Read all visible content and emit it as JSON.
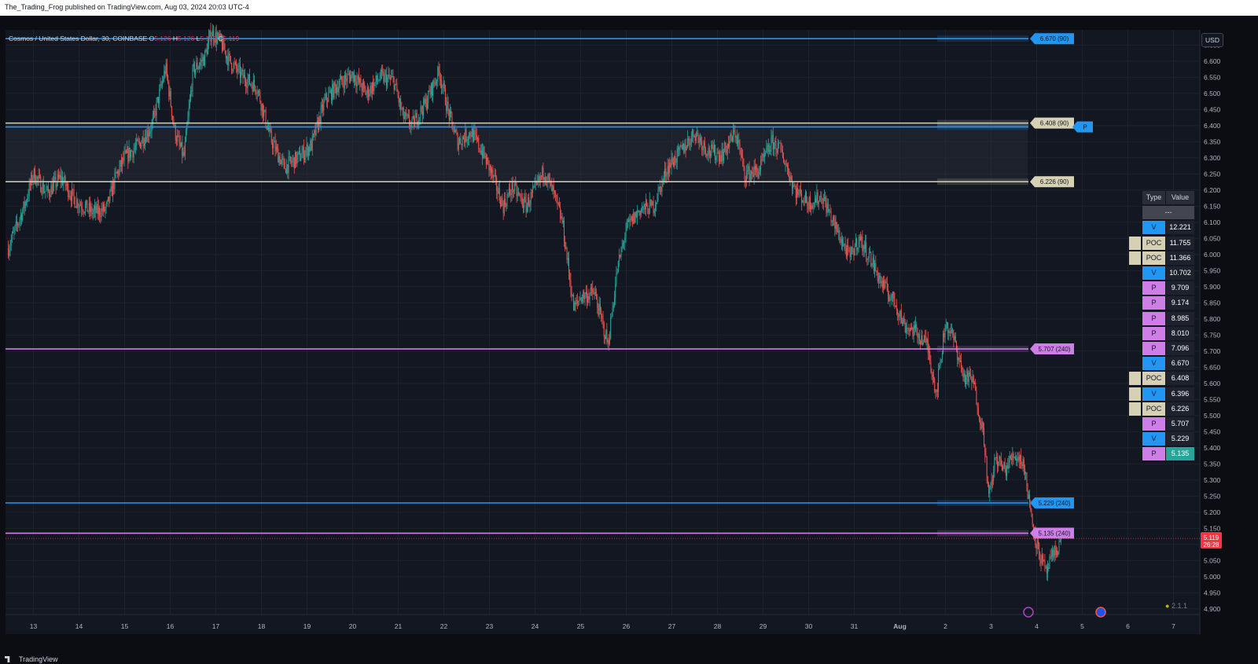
{
  "header": {
    "published_text": "The_Trading_Frog published on TradingView.com, Aug 03, 2024 20:03 UTC-4"
  },
  "symbol": {
    "title": "Cosmos / United States Dollar, 30, COINBASE",
    "o_label": "O",
    "o_value": "5.126",
    "h_label": "H",
    "h_value": "5.126",
    "l_label": "L",
    "l_value": "5.119",
    "c_label": "C",
    "c_value": "5.119"
  },
  "currency_button": "USD",
  "footer": {
    "brand": "TradingView"
  },
  "version_label": "2.1.1",
  "colors": {
    "bg": "#131722",
    "up": "#26a69a",
    "down": "#ef5350",
    "blue": "#2196f3",
    "purple": "#ce7ee6",
    "poc": "#d6d0b4",
    "last": "#f23645"
  },
  "chart_data": {
    "type": "candlestick",
    "title": "Cosmos / United States Dollar, 30, COINBASE",
    "ylim": [
      4.9,
      6.69
    ],
    "y_ticks": [
      "6.650",
      "6.600",
      "6.550",
      "6.500",
      "6.450",
      "6.400",
      "6.350",
      "6.300",
      "6.250",
      "6.200",
      "6.150",
      "6.100",
      "6.050",
      "6.000",
      "5.950",
      "5.900",
      "5.850",
      "5.800",
      "5.750",
      "5.700",
      "5.650",
      "5.600",
      "5.550",
      "5.500",
      "5.450",
      "5.400",
      "5.350",
      "5.300",
      "5.250",
      "5.200",
      "5.150",
      "5.100",
      "5.050",
      "5.000",
      "4.950",
      "4.900"
    ],
    "x_ticks": [
      "13",
      "14",
      "15",
      "16",
      "17",
      "18",
      "19",
      "20",
      "21",
      "22",
      "23",
      "24",
      "25",
      "26",
      "27",
      "28",
      "29",
      "30",
      "31",
      "Aug",
      "2",
      "3",
      "4",
      "5",
      "6",
      "7"
    ],
    "price_path": [
      [
        12.45,
        6.02
      ],
      [
        12.8,
        6.15
      ],
      [
        13.0,
        6.25
      ],
      [
        13.3,
        6.19
      ],
      [
        13.6,
        6.24
      ],
      [
        13.9,
        6.17
      ],
      [
        14.3,
        6.13
      ],
      [
        14.6,
        6.14
      ],
      [
        14.8,
        6.24
      ],
      [
        15.0,
        6.3
      ],
      [
        15.3,
        6.34
      ],
      [
        15.6,
        6.4
      ],
      [
        15.9,
        6.58
      ],
      [
        16.1,
        6.38
      ],
      [
        16.3,
        6.3
      ],
      [
        16.5,
        6.57
      ],
      [
        16.75,
        6.61
      ],
      [
        16.9,
        6.69
      ],
      [
        17.1,
        6.66
      ],
      [
        17.3,
        6.6
      ],
      [
        17.6,
        6.55
      ],
      [
        17.9,
        6.52
      ],
      [
        18.2,
        6.36
      ],
      [
        18.5,
        6.27
      ],
      [
        18.8,
        6.3
      ],
      [
        19.1,
        6.34
      ],
      [
        19.4,
        6.48
      ],
      [
        19.7,
        6.53
      ],
      [
        20.0,
        6.56
      ],
      [
        20.3,
        6.5
      ],
      [
        20.6,
        6.55
      ],
      [
        20.9,
        6.54
      ],
      [
        21.1,
        6.43
      ],
      [
        21.3,
        6.4
      ],
      [
        21.6,
        6.47
      ],
      [
        21.9,
        6.57
      ],
      [
        22.1,
        6.44
      ],
      [
        22.3,
        6.35
      ],
      [
        22.6,
        6.38
      ],
      [
        22.8,
        6.33
      ],
      [
        23.0,
        6.27
      ],
      [
        23.3,
        6.15
      ],
      [
        23.5,
        6.21
      ],
      [
        23.8,
        6.15
      ],
      [
        24.0,
        6.2
      ],
      [
        24.2,
        6.26
      ],
      [
        24.4,
        6.19
      ],
      [
        24.6,
        6.1
      ],
      [
        24.85,
        5.83
      ],
      [
        25.0,
        5.87
      ],
      [
        25.3,
        5.88
      ],
      [
        25.6,
        5.72
      ],
      [
        25.8,
        5.95
      ],
      [
        26.0,
        6.08
      ],
      [
        26.3,
        6.14
      ],
      [
        26.6,
        6.15
      ],
      [
        26.9,
        6.27
      ],
      [
        27.2,
        6.32
      ],
      [
        27.5,
        6.38
      ],
      [
        27.8,
        6.32
      ],
      [
        28.1,
        6.31
      ],
      [
        28.4,
        6.38
      ],
      [
        28.6,
        6.25
      ],
      [
        28.9,
        6.26
      ],
      [
        29.2,
        6.35
      ],
      [
        29.4,
        6.32
      ],
      [
        29.7,
        6.2
      ],
      [
        30.0,
        6.16
      ],
      [
        30.3,
        6.18
      ],
      [
        30.6,
        6.08
      ],
      [
        30.9,
        5.99
      ],
      [
        31.1,
        6.05
      ],
      [
        31.35,
        5.99
      ],
      [
        31.6,
        5.91
      ],
      [
        31.9,
        5.85
      ],
      [
        32.1,
        5.78
      ],
      [
        32.35,
        5.76
      ],
      [
        32.6,
        5.72
      ],
      [
        32.8,
        5.57
      ],
      [
        33.0,
        5.79
      ],
      [
        33.2,
        5.73
      ],
      [
        33.4,
        5.62
      ],
      [
        33.6,
        5.61
      ],
      [
        33.85,
        5.43
      ],
      [
        33.95,
        5.24
      ],
      [
        34.1,
        5.37
      ],
      [
        34.3,
        5.33
      ],
      [
        34.5,
        5.38
      ],
      [
        34.7,
        5.36
      ],
      [
        34.85,
        5.22
      ],
      [
        35.0,
        5.1
      ],
      [
        35.2,
        5.01
      ],
      [
        35.35,
        5.06
      ],
      [
        35.55,
        5.12
      ]
    ],
    "levels": [
      {
        "type": "V",
        "value": 6.67,
        "label": "6.670 (90)",
        "color": "blue"
      },
      {
        "type": "POC",
        "value": 6.408,
        "label": "6.408 (90)",
        "color": "poc"
      },
      {
        "type": "V",
        "value": 6.396,
        "label": "P",
        "color": "blue"
      },
      {
        "type": "POC",
        "value": 6.226,
        "label": "6.226 (90)",
        "color": "poc"
      },
      {
        "type": "P",
        "value": 5.707,
        "label": "5.707 (240)",
        "color": "purple"
      },
      {
        "type": "V",
        "value": 5.229,
        "label": "5.229 (240)",
        "color": "blue"
      },
      {
        "type": "P",
        "value": 5.135,
        "label": "5.135 (240)",
        "color": "purple"
      }
    ],
    "last_price": {
      "value": 5.119,
      "label": "5.119",
      "countdown": "26:28"
    },
    "table": {
      "header": [
        "Type",
        "Value"
      ],
      "subheader": "---",
      "rows": [
        {
          "type": "V",
          "value": "12.221",
          "kind": "blue",
          "flag": false
        },
        {
          "type": "POC",
          "value": "11.755",
          "kind": "poc",
          "flag": true
        },
        {
          "type": "POC",
          "value": "11.366",
          "kind": "poc",
          "flag": true
        },
        {
          "type": "V",
          "value": "10.702",
          "kind": "blue",
          "flag": false
        },
        {
          "type": "P",
          "value": "9.709",
          "kind": "purple",
          "flag": false
        },
        {
          "type": "P",
          "value": "9.174",
          "kind": "purple",
          "flag": false
        },
        {
          "type": "P",
          "value": "8.985",
          "kind": "purple",
          "flag": false
        },
        {
          "type": "P",
          "value": "8.010",
          "kind": "purple",
          "flag": false
        },
        {
          "type": "P",
          "value": "7.096",
          "kind": "purple",
          "flag": false
        },
        {
          "type": "V",
          "value": "6.670",
          "kind": "blue",
          "flag": false
        },
        {
          "type": "POC",
          "value": "6.408",
          "kind": "poc",
          "flag": true
        },
        {
          "type": "V",
          "value": "6.396",
          "kind": "blue",
          "flag": true
        },
        {
          "type": "POC",
          "value": "6.226",
          "kind": "poc",
          "flag": true
        },
        {
          "type": "P",
          "value": "5.707",
          "kind": "purple",
          "flag": false
        },
        {
          "type": "V",
          "value": "5.229",
          "kind": "blue",
          "flag": false
        },
        {
          "type": "P",
          "value": "5.135",
          "kind": "purple",
          "flag": false,
          "highlight": true
        }
      ]
    }
  }
}
